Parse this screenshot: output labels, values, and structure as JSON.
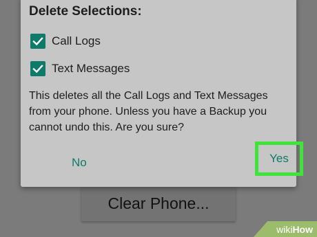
{
  "dialog": {
    "title": "Delete Selections:",
    "options": [
      {
        "label": "Call Logs",
        "checked": true
      },
      {
        "label": "Text Messages",
        "checked": true
      }
    ],
    "message": "This deletes all the Call Logs and Text Messages from your phone. Unless you have a Backup you cannot undo this. Are you sure?",
    "no_label": "No",
    "yes_label": "Yes"
  },
  "background": {
    "button_label": "Clear Phone..."
  },
  "watermark": {
    "part1": "wiki",
    "part2": "How"
  },
  "colors": {
    "accent": "#0d7a6a",
    "highlight": "#3fe33a",
    "dialog_bg": "#c6c6c6"
  }
}
